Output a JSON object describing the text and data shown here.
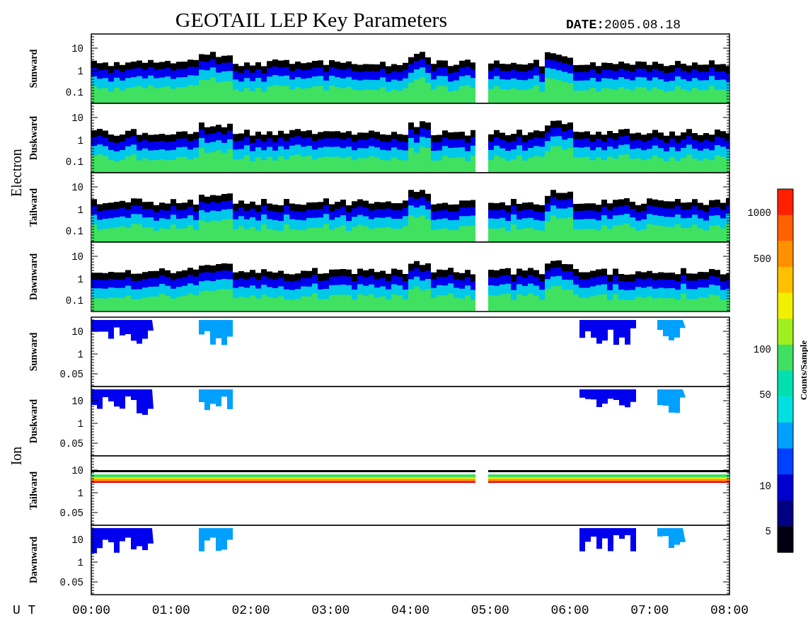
{
  "title": "GEOTAIL LEP Key Parameters",
  "date_label": "DATE:",
  "date": "2005.08.18",
  "groups": [
    {
      "kind": "electron",
      "label": "Electron",
      "panels": [
        {
          "label": "Sunward",
          "yticks": [
            "10",
            "1",
            "0.1"
          ]
        },
        {
          "label": "Duskward",
          "yticks": [
            "10",
            "1",
            "0.1"
          ]
        },
        {
          "label": "Tailward",
          "yticks": [
            "10",
            "1",
            "0.1"
          ]
        },
        {
          "label": "Dawnward",
          "yticks": [
            "10",
            "1",
            "0.1"
          ]
        }
      ]
    },
    {
      "kind": "ion",
      "label": "Ion",
      "panels": [
        {
          "label": "Sunward",
          "yticks": [
            "10",
            "1",
            "0.05"
          ]
        },
        {
          "label": "Duskward",
          "yticks": [
            "10",
            "1",
            "0.05"
          ]
        },
        {
          "label": "Tailward",
          "yticks": [
            "10",
            "1",
            "0.05"
          ]
        },
        {
          "label": "Dawnward",
          "yticks": [
            "10",
            "1",
            "0.05"
          ]
        }
      ]
    }
  ],
  "time_axis": {
    "label": "U T",
    "ticks": [
      "00:00",
      "01:00",
      "02:00",
      "03:00",
      "04:00",
      "05:00",
      "06:00",
      "07:00",
      "08:00"
    ]
  },
  "colorbar": {
    "label": "Counts/Sample",
    "ticks": [
      "1000",
      "500",
      "100",
      "50",
      "10",
      "5"
    ]
  }
}
